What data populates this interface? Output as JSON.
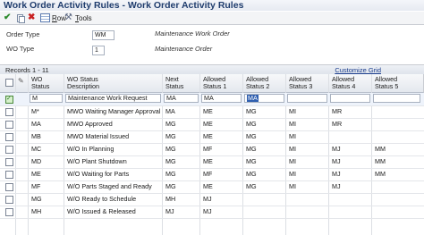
{
  "window": {
    "title": "Work Order Activity Rules - Work Order Activity Rules"
  },
  "toolbar": {
    "ok_icon": "checkmark-icon",
    "copy_icon": "copy-icon",
    "delete_icon": "delete-icon",
    "row_label": "Row",
    "row_underline": "R",
    "row_rest": "ow",
    "tools_label": "Tools",
    "tools_underline": "T",
    "tools_rest": "ools"
  },
  "form": {
    "order_type_label": "Order Type",
    "order_type_value": "WM",
    "order_type_desc": "Maintenance Work Order",
    "wo_type_label": "WO Type",
    "wo_type_value": "1",
    "wo_type_desc": "Maintenance Order"
  },
  "grid": {
    "records_label": "Records 1 - 11",
    "customize_label": "Customize Grid",
    "headers": {
      "wo_status": "WO\nStatus",
      "wo_status_desc": "WO Status\nDescription",
      "next_status": "Next\nStatus",
      "allowed1": "Allowed\nStatus 1",
      "allowed2": "Allowed\nStatus 2",
      "allowed3": "Allowed\nStatus 3",
      "allowed4": "Allowed\nStatus 4",
      "allowed5": "Allowed\nStatus 5"
    },
    "rows": [
      {
        "status": "M",
        "desc": "Maintenance Work Request",
        "next": "MA",
        "a1": "MA",
        "a2": "MA",
        "a3": "",
        "a4": "",
        "a5": "",
        "selected": true
      },
      {
        "status": "M*",
        "desc": "MWO Waiting Manager Approval",
        "next": "MA",
        "a1": "ME",
        "a2": "MG",
        "a3": "MI",
        "a4": "MR",
        "a5": ""
      },
      {
        "status": "MA",
        "desc": "MWO Approved",
        "next": "MG",
        "a1": "ME",
        "a2": "MG",
        "a3": "MI",
        "a4": "MR",
        "a5": ""
      },
      {
        "status": "MB",
        "desc": "MWO Material Issued",
        "next": "MG",
        "a1": "ME",
        "a2": "MG",
        "a3": "MI",
        "a4": "",
        "a5": ""
      },
      {
        "status": "MC",
        "desc": "W/O In Planning",
        "next": "MG",
        "a1": "MF",
        "a2": "MG",
        "a3": "MI",
        "a4": "MJ",
        "a5": "MM"
      },
      {
        "status": "MD",
        "desc": "W/O Plant Shutdown",
        "next": "MG",
        "a1": "ME",
        "a2": "MG",
        "a3": "MI",
        "a4": "MJ",
        "a5": "MM"
      },
      {
        "status": "ME",
        "desc": "W/O Waiting for Parts",
        "next": "MG",
        "a1": "MF",
        "a2": "MG",
        "a3": "MI",
        "a4": "MJ",
        "a5": "MM"
      },
      {
        "status": "MF",
        "desc": "W/O Parts Staged and Ready",
        "next": "MG",
        "a1": "ME",
        "a2": "MG",
        "a3": "MI",
        "a4": "MJ",
        "a5": ""
      },
      {
        "status": "MG",
        "desc": "W/O Ready to Schedule",
        "next": "MH",
        "a1": "MJ",
        "a2": "",
        "a3": "",
        "a4": "",
        "a5": ""
      },
      {
        "status": "MH",
        "desc": "W/O Issued & Released",
        "next": "MJ",
        "a1": "MJ",
        "a2": "",
        "a3": "",
        "a4": "",
        "a5": ""
      }
    ]
  },
  "colors": {
    "title": "#1f3c6d",
    "link": "#1a3c8c",
    "selection": "#2f5fb0"
  }
}
